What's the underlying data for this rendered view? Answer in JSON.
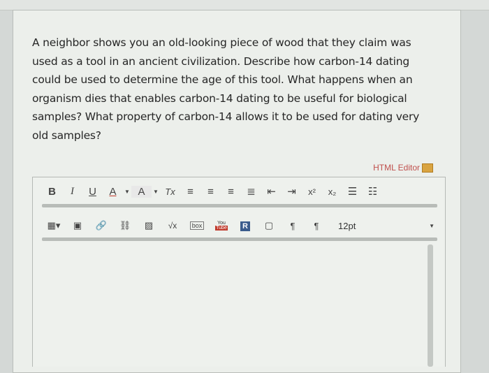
{
  "question": {
    "lines": [
      "A neighbor shows you an old-looking piece of wood that they claim was",
      "used as a tool in an ancient civilization. Describe how carbon-14 dating",
      "could be used to determine the age of this tool. What happens when an",
      "organism dies that enables carbon-14 dating to be useful for biological",
      "samples? What property of carbon-14 allows it to be used for dating very",
      "old samples?"
    ]
  },
  "editor": {
    "html_editor_label": "HTML Editor",
    "toolbar1": {
      "bold": "B",
      "italic": "I",
      "underline": "U",
      "font_color": "A",
      "bg_color": "A",
      "clear_format": "Tx",
      "superscript": "x²",
      "subscript": "x₂"
    },
    "toolbar2": {
      "sqrt": "√x",
      "box": "box",
      "youtube_top": "You",
      "youtube_bottom": "Tube",
      "r_label": "R",
      "ltr": "¶",
      "rtl": "¶",
      "font_size": "12pt"
    }
  },
  "colors": {
    "html_editor_link": "#c0504d",
    "page_bg": "#ecefeb"
  }
}
